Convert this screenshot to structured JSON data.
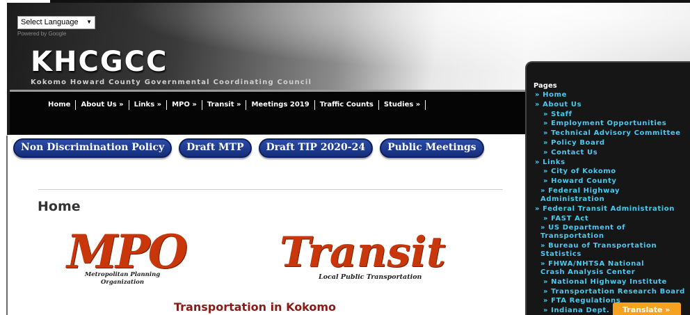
{
  "language_select": {
    "value": "Select Language",
    "powered_by": "Powered by Google"
  },
  "site": {
    "title": "KHCGCC",
    "subtitle": "Kokomo Howard County Governmental Coordinating Council"
  },
  "nav": [
    "Home",
    "About Us »",
    "Links »",
    "MPO »",
    "Transit »",
    "Meetings 2019",
    "Traffic Counts",
    "Studies »"
  ],
  "buttons": [
    "Non Discrimination Policy",
    "Draft MTP",
    "Draft TIP 2020-24",
    "Public Meetings"
  ],
  "main": {
    "page_title": "Home",
    "mpo_logo": "MPO",
    "mpo_subtitle": "Metropolitan Planning Organization",
    "transit_logo": "Transit",
    "transit_subtitle": "Local Public Transportation",
    "section_heading": "Transportation in Kokomo"
  },
  "sidebar": {
    "heading": "Pages",
    "items": [
      "» Home",
      "» About Us",
      "» Staff",
      "» Employment Opportunities",
      "» Technical Advisory Committee",
      "» Policy Board",
      "» Contact Us",
      "» Links",
      "» City of Kokomo",
      "» Howard County",
      "» Federal Highway Administration",
      "» Federal Transit Administration",
      "» FAST Act",
      "» US Department of Transportation",
      "» Bureau of Transportation Statistics",
      "» FHWA/NHTSA National Crash Analysis Center",
      "» National Highway Institute",
      "» Transportation Research Board",
      "» FTA Regulations",
      "» Indiana Dept."
    ]
  },
  "translate_button": "Translate »"
}
